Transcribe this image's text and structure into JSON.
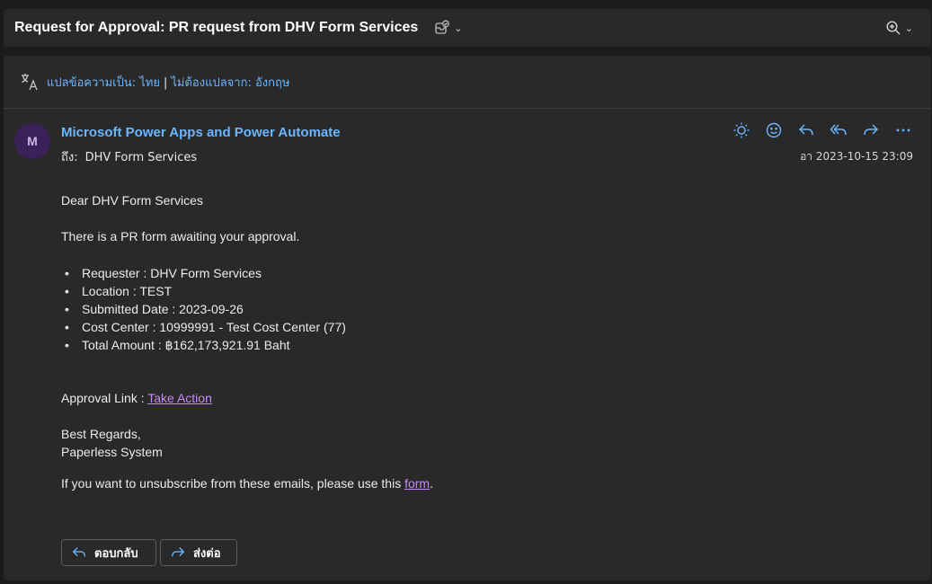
{
  "subject": {
    "title": "Request for Approval: PR request from DHV Form Services",
    "chevron": "⌄"
  },
  "translate": {
    "translate_to": "แปลข้อความเป็น: ไทย",
    "separator": "|",
    "dont_translate": "ไม่ต้องแปลจาก: อังกฤษ"
  },
  "sender": {
    "avatar_initial": "M",
    "name": "Microsoft Power Apps and Power Automate",
    "to_label": "ถึง:",
    "to_value": "DHV Form Services",
    "datetime": "อา 2023-10-15 23:09"
  },
  "body": {
    "greeting": "Dear DHV Form Services",
    "intro": "There is a PR form awaiting your approval.",
    "bullet_glyph": "•",
    "details": [
      "Requester : DHV Form Services",
      "Location : TEST",
      "Submitted Date : 2023-09-26",
      "Cost Center :  10999991 - Test Cost Center (77)",
      "Total Amount :  ฿162,173,921.91 Baht"
    ],
    "approval_label": "Approval Link : ",
    "approval_link": "Take Action",
    "regards_1": "Best Regards,",
    "regards_2": "Paperless System",
    "unsubscribe_text": "If you want to unsubscribe from these emails, please use this ",
    "unsubscribe_link": "form",
    "unsubscribe_end": "."
  },
  "buttons": {
    "reply": "ตอบกลับ",
    "forward": "ส่งต่อ"
  },
  "colors": {
    "accent_blue": "#6cb6ff",
    "link_purple": "#c58af9",
    "avatar_bg": "#3a2157"
  }
}
